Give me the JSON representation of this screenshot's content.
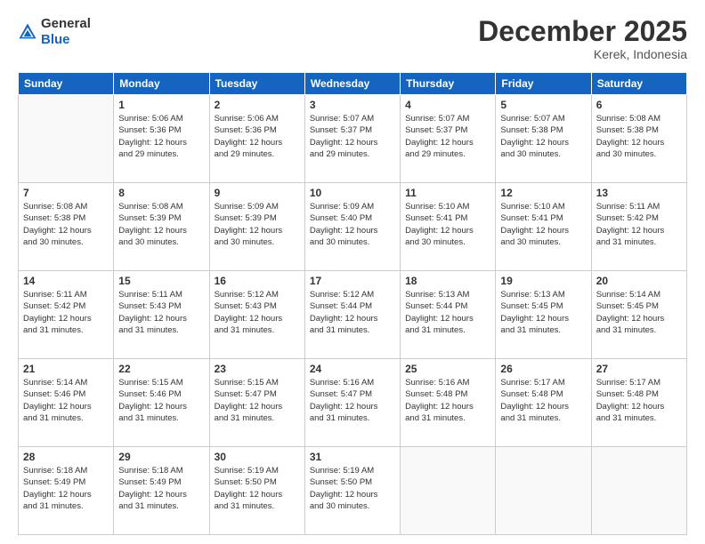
{
  "logo": {
    "general": "General",
    "blue": "Blue"
  },
  "title": "December 2025",
  "subtitle": "Kerek, Indonesia",
  "days_header": [
    "Sunday",
    "Monday",
    "Tuesday",
    "Wednesday",
    "Thursday",
    "Friday",
    "Saturday"
  ],
  "weeks": [
    [
      {
        "day": "",
        "info": ""
      },
      {
        "day": "1",
        "info": "Sunrise: 5:06 AM\nSunset: 5:36 PM\nDaylight: 12 hours\nand 29 minutes."
      },
      {
        "day": "2",
        "info": "Sunrise: 5:06 AM\nSunset: 5:36 PM\nDaylight: 12 hours\nand 29 minutes."
      },
      {
        "day": "3",
        "info": "Sunrise: 5:07 AM\nSunset: 5:37 PM\nDaylight: 12 hours\nand 29 minutes."
      },
      {
        "day": "4",
        "info": "Sunrise: 5:07 AM\nSunset: 5:37 PM\nDaylight: 12 hours\nand 29 minutes."
      },
      {
        "day": "5",
        "info": "Sunrise: 5:07 AM\nSunset: 5:38 PM\nDaylight: 12 hours\nand 30 minutes."
      },
      {
        "day": "6",
        "info": "Sunrise: 5:08 AM\nSunset: 5:38 PM\nDaylight: 12 hours\nand 30 minutes."
      }
    ],
    [
      {
        "day": "7",
        "info": "Sunrise: 5:08 AM\nSunset: 5:38 PM\nDaylight: 12 hours\nand 30 minutes."
      },
      {
        "day": "8",
        "info": "Sunrise: 5:08 AM\nSunset: 5:39 PM\nDaylight: 12 hours\nand 30 minutes."
      },
      {
        "day": "9",
        "info": "Sunrise: 5:09 AM\nSunset: 5:39 PM\nDaylight: 12 hours\nand 30 minutes."
      },
      {
        "day": "10",
        "info": "Sunrise: 5:09 AM\nSunset: 5:40 PM\nDaylight: 12 hours\nand 30 minutes."
      },
      {
        "day": "11",
        "info": "Sunrise: 5:10 AM\nSunset: 5:41 PM\nDaylight: 12 hours\nand 30 minutes."
      },
      {
        "day": "12",
        "info": "Sunrise: 5:10 AM\nSunset: 5:41 PM\nDaylight: 12 hours\nand 30 minutes."
      },
      {
        "day": "13",
        "info": "Sunrise: 5:11 AM\nSunset: 5:42 PM\nDaylight: 12 hours\nand 31 minutes."
      }
    ],
    [
      {
        "day": "14",
        "info": "Sunrise: 5:11 AM\nSunset: 5:42 PM\nDaylight: 12 hours\nand 31 minutes."
      },
      {
        "day": "15",
        "info": "Sunrise: 5:11 AM\nSunset: 5:43 PM\nDaylight: 12 hours\nand 31 minutes."
      },
      {
        "day": "16",
        "info": "Sunrise: 5:12 AM\nSunset: 5:43 PM\nDaylight: 12 hours\nand 31 minutes."
      },
      {
        "day": "17",
        "info": "Sunrise: 5:12 AM\nSunset: 5:44 PM\nDaylight: 12 hours\nand 31 minutes."
      },
      {
        "day": "18",
        "info": "Sunrise: 5:13 AM\nSunset: 5:44 PM\nDaylight: 12 hours\nand 31 minutes."
      },
      {
        "day": "19",
        "info": "Sunrise: 5:13 AM\nSunset: 5:45 PM\nDaylight: 12 hours\nand 31 minutes."
      },
      {
        "day": "20",
        "info": "Sunrise: 5:14 AM\nSunset: 5:45 PM\nDaylight: 12 hours\nand 31 minutes."
      }
    ],
    [
      {
        "day": "21",
        "info": "Sunrise: 5:14 AM\nSunset: 5:46 PM\nDaylight: 12 hours\nand 31 minutes."
      },
      {
        "day": "22",
        "info": "Sunrise: 5:15 AM\nSunset: 5:46 PM\nDaylight: 12 hours\nand 31 minutes."
      },
      {
        "day": "23",
        "info": "Sunrise: 5:15 AM\nSunset: 5:47 PM\nDaylight: 12 hours\nand 31 minutes."
      },
      {
        "day": "24",
        "info": "Sunrise: 5:16 AM\nSunset: 5:47 PM\nDaylight: 12 hours\nand 31 minutes."
      },
      {
        "day": "25",
        "info": "Sunrise: 5:16 AM\nSunset: 5:48 PM\nDaylight: 12 hours\nand 31 minutes."
      },
      {
        "day": "26",
        "info": "Sunrise: 5:17 AM\nSunset: 5:48 PM\nDaylight: 12 hours\nand 31 minutes."
      },
      {
        "day": "27",
        "info": "Sunrise: 5:17 AM\nSunset: 5:48 PM\nDaylight: 12 hours\nand 31 minutes."
      }
    ],
    [
      {
        "day": "28",
        "info": "Sunrise: 5:18 AM\nSunset: 5:49 PM\nDaylight: 12 hours\nand 31 minutes."
      },
      {
        "day": "29",
        "info": "Sunrise: 5:18 AM\nSunset: 5:49 PM\nDaylight: 12 hours\nand 31 minutes."
      },
      {
        "day": "30",
        "info": "Sunrise: 5:19 AM\nSunset: 5:50 PM\nDaylight: 12 hours\nand 31 minutes."
      },
      {
        "day": "31",
        "info": "Sunrise: 5:19 AM\nSunset: 5:50 PM\nDaylight: 12 hours\nand 30 minutes."
      },
      {
        "day": "",
        "info": ""
      },
      {
        "day": "",
        "info": ""
      },
      {
        "day": "",
        "info": ""
      }
    ]
  ]
}
